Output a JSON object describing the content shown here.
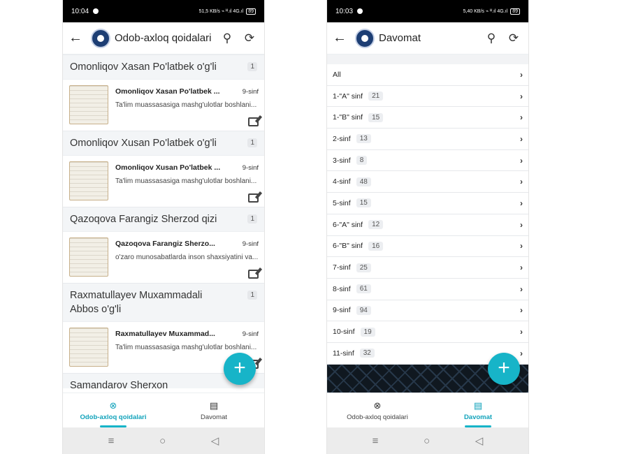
{
  "left": {
    "status": {
      "time": "10:04",
      "right": "51,5 KB/s ⌁ ᴴ.ıl 4G.ıl",
      "battery": "89"
    },
    "appbar": {
      "title": "Odob-axloq qoidalari"
    },
    "groups": [
      {
        "name": "Omonliqov Xasan Po'latbek o'g'li",
        "count": "1",
        "item": {
          "name": "Omonliqov Xasan Po'latbek ...",
          "grade": "9-sinf",
          "desc": "Ta'lim muassasasiga mashg'ulotlar boshlani..."
        }
      },
      {
        "name": "Omonliqov Xusan Po'latbek o'g'li",
        "count": "1",
        "item": {
          "name": "Omonliqov Xusan Po'latbek ...",
          "grade": "9-sinf",
          "desc": "Ta'lim muassasasiga mashg'ulotlar boshlani..."
        }
      },
      {
        "name": "Qazoqova Farangiz Sherzod qizi",
        "count": "1",
        "item": {
          "name": "Qazoqova Farangiz Sherzo...",
          "grade": "9-sinf",
          "desc": "o'zaro munosabatlarda inson shaxsiyatini va..."
        }
      },
      {
        "name": "Raxmatullayev Muxammadali Abbos o'g'li",
        "count": "1",
        "item": {
          "name": "Raxmatullayev Muxammad...",
          "grade": "9-sinf",
          "desc": "Ta'lim muassasasiga mashg'ulotlar boshlani..."
        }
      },
      {
        "name": "Samandarov Sherxon Samandar o'g'li",
        "count": ""
      }
    ],
    "nav": {
      "tab1": "Odob-axloq qoidalari",
      "tab2": "Davomat"
    }
  },
  "right": {
    "status": {
      "time": "10:03",
      "right": "5,40 KB/s ⌁ ᴴ.ıl 4G.ıl",
      "battery": "89"
    },
    "appbar": {
      "title": "Davomat"
    },
    "rows": [
      {
        "label": "All",
        "count": ""
      },
      {
        "label": "1-\"A\" sinf",
        "count": "21"
      },
      {
        "label": "1-\"B\" sinf",
        "count": "15"
      },
      {
        "label": "2-sinf",
        "count": "13"
      },
      {
        "label": "3-sinf",
        "count": "8"
      },
      {
        "label": "4-sinf",
        "count": "48"
      },
      {
        "label": "5-sinf",
        "count": "15"
      },
      {
        "label": "6-\"A\" sinf",
        "count": "12"
      },
      {
        "label": "6-\"B\" sinf",
        "count": "16"
      },
      {
        "label": "7-sinf",
        "count": "25"
      },
      {
        "label": "8-sinf",
        "count": "61"
      },
      {
        "label": "9-sinf",
        "count": "94"
      },
      {
        "label": "10-sinf",
        "count": "19"
      },
      {
        "label": "11-sinf",
        "count": "32"
      }
    ],
    "nav": {
      "tab1": "Odob-axloq qoidalari",
      "tab2": "Davomat"
    }
  },
  "icons": {
    "back": "arrow-left-icon",
    "search": "search-icon",
    "refresh": "refresh-icon",
    "fab": "plus-icon",
    "edit": "edit-icon",
    "chevron": "chevron-right-icon"
  },
  "colors": {
    "accent": "#17b4c8",
    "active_nav": "#12a3bb",
    "header_bg": "#f3f5f7"
  }
}
